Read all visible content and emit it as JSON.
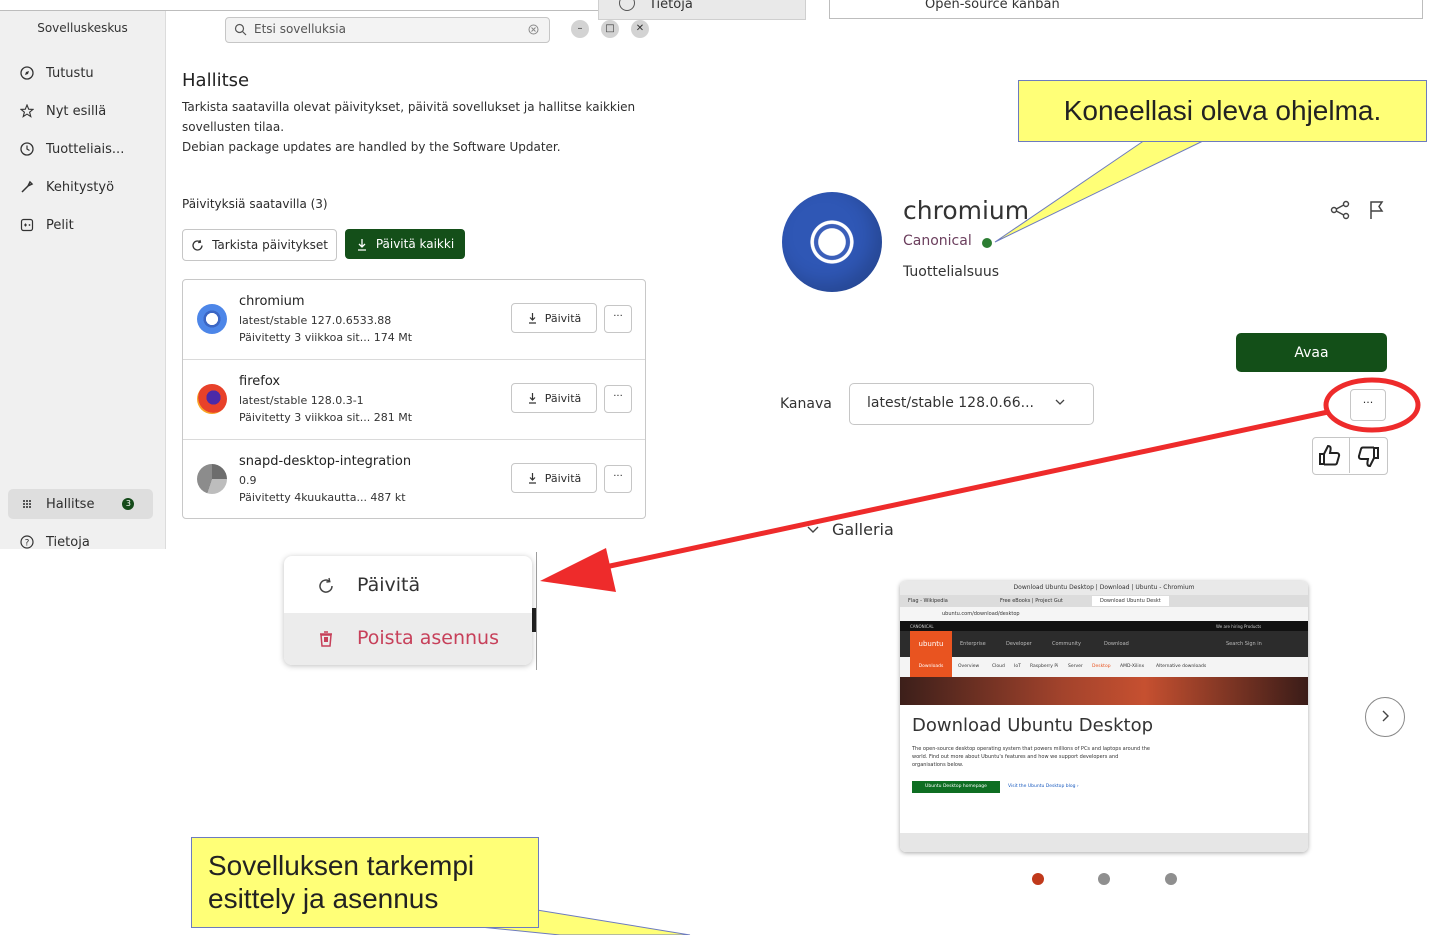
{
  "top_fragments": {
    "about_label": "Tietoja",
    "right_box_text": "Open-source kanban"
  },
  "sidebar": {
    "title": "Sovelluskeskus",
    "items": [
      {
        "label": "Tutustu",
        "icon": "compass-icon"
      },
      {
        "label": "Nyt esillä",
        "icon": "star-icon"
      },
      {
        "label": "Tuotteliais...",
        "icon": "clock-icon"
      },
      {
        "label": "Kehitystyö",
        "icon": "wrench-icon"
      },
      {
        "label": "Pelit",
        "icon": "gamepad-icon"
      }
    ],
    "manage": {
      "label": "Hallitse",
      "badge": "3",
      "icon": "grid-icon"
    },
    "about": {
      "label": "Tietoja",
      "icon": "question-icon"
    }
  },
  "search": {
    "placeholder": "Etsi sovelluksia"
  },
  "window_controls": {
    "minimize": "–",
    "maximize": "□",
    "close": "✕"
  },
  "manage_page": {
    "title": "Hallitse",
    "desc_line1": "Tarkista saatavilla olevat päivitykset, päivitä sovellukset ja hallitse kaikkien",
    "desc_line2": "sovellusten tilaa.",
    "desc_line3": "Debian package updates are handled by the Software Updater.",
    "updates_header": "Päivityksiä saatavilla (3)",
    "check_button": "Tarkista päivitykset",
    "update_all_button": "Päivitä kaikki",
    "apps": [
      {
        "name": "chromium",
        "version": "latest/stable 127.0.6533.88",
        "updated": "Päivitetty 3 viikkoa sit... 174 Mt",
        "button": "Päivitä",
        "more": "···"
      },
      {
        "name": "firefox",
        "version": "latest/stable 128.0.3-1",
        "updated": "Päivitetty 3 viikkoa sit... 281 Mt",
        "button": "Päivitä",
        "more": "···"
      },
      {
        "name": "snapd-desktop-integration",
        "version": "0.9",
        "updated": "Päivitetty 4kuukautta... 487 kt",
        "button": "Päivitä",
        "more": "···"
      }
    ]
  },
  "context_menu": {
    "items": [
      {
        "label": "Päivitä",
        "icon": "refresh-icon"
      },
      {
        "label": "Poista asennus",
        "icon": "trash-icon"
      }
    ]
  },
  "app_detail": {
    "name": "chromium",
    "publisher": "Canonical",
    "category": "Tuottelialsuus",
    "open_button": "Avaa",
    "channel_label": "Kanava",
    "channel_value": "latest/stable 128.0.66...",
    "more_button": "···",
    "gallery_label": "Galleria",
    "gallery_dots": 3,
    "gallery_active_dot": 1
  },
  "screenshot_preview": {
    "window_title": "Download Ubuntu Desktop | Download | Ubuntu - Chromium",
    "tab1": "Flag - Wikipedia",
    "tab2": "Free eBooks | Project Gut",
    "tab3": "Download Ubuntu Deskt",
    "url": "ubuntu.com/download/desktop",
    "brand": "ubuntu",
    "top_left": "CANONICAL",
    "top_right": "We are hiring   Products",
    "nav_items": [
      "Enterprise",
      "Developer",
      "Community",
      "Download"
    ],
    "nav_right": "Search   Sign in",
    "subnav": [
      "Downloads",
      "Overview",
      "Cloud",
      "IoT",
      "Raspberry Pi",
      "Server",
      "Desktop",
      "AMD-Xilinx",
      "Alternative downloads"
    ],
    "heading": "Download Ubuntu Desktop",
    "body": "The open-source desktop operating system that powers millions of PCs and laptops around the world. Find out more about Ubuntu's features and how we support developers and organisations below.",
    "cta_button": "Ubuntu Desktop homepage",
    "cta_link": "Visit the Ubuntu Desktop blog ›"
  },
  "callouts": {
    "program": "Koneellasi oleva ohjelma.",
    "intro_line1": "Sovelluksen tarkempi",
    "intro_line2": "esittely ja asennus"
  },
  "colors": {
    "accent_green": "#144f19",
    "uninstall_red": "#c7405a",
    "callout_yellow": "#ffff77",
    "arrow_red": "#ee2b2b",
    "ubuntu_orange": "#e95420"
  }
}
